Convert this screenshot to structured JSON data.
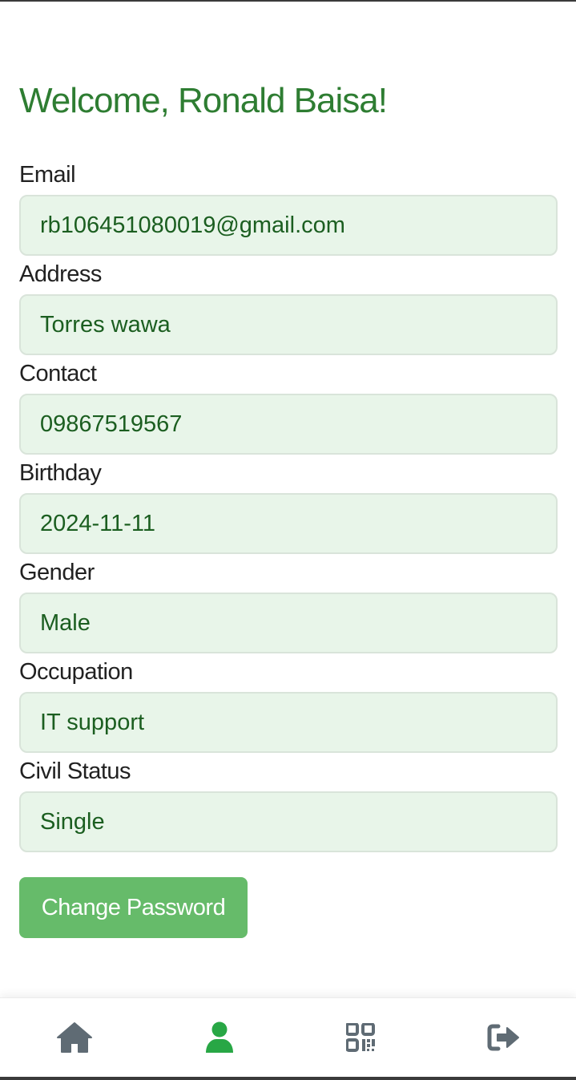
{
  "header": {
    "welcome_text": "Welcome, Ronald Baisa!"
  },
  "profile": {
    "fields": [
      {
        "label": "Email",
        "value": "rb106451080019@gmail.com"
      },
      {
        "label": "Address",
        "value": "Torres wawa"
      },
      {
        "label": "Contact",
        "value": "09867519567"
      },
      {
        "label": "Birthday",
        "value": "2024-11-11"
      },
      {
        "label": "Gender",
        "value": "Male"
      },
      {
        "label": "Occupation",
        "value": "IT support"
      },
      {
        "label": "Civil Status",
        "value": "Single"
      }
    ],
    "change_password_label": "Change Password"
  },
  "bottom_nav": {
    "items": [
      {
        "icon": "home-icon",
        "active": false
      },
      {
        "icon": "user-icon",
        "active": true
      },
      {
        "icon": "qrcode-icon",
        "active": false
      },
      {
        "icon": "logout-icon",
        "active": false
      }
    ]
  },
  "colors": {
    "primary_green": "#2e7d32",
    "active_nav": "#28a745",
    "inactive_nav": "#5f6b74",
    "field_bg": "#e8f5e9",
    "button_bg": "#66bb6a"
  }
}
